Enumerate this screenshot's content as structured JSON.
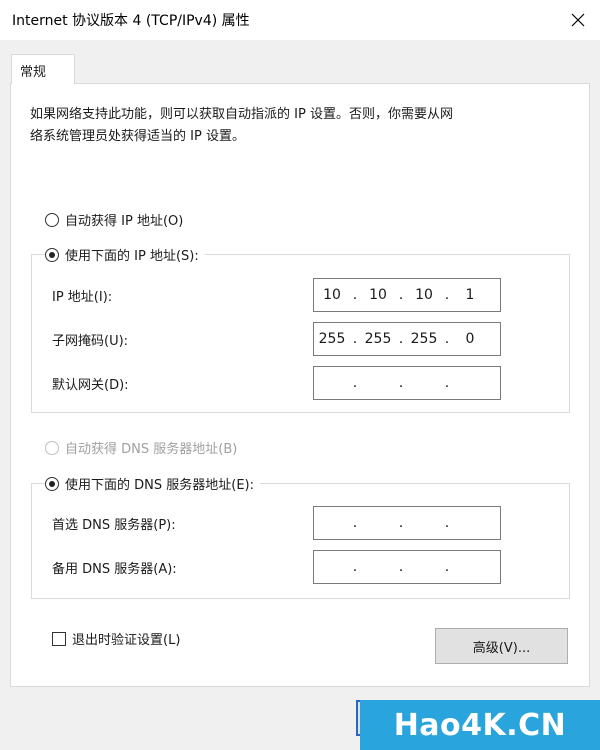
{
  "window": {
    "title": "Internet 协议版本 4 (TCP/IPv4) 属性"
  },
  "tabs": [
    {
      "label": "常规",
      "selected": true
    }
  ],
  "description": {
    "line1": "如果网络支持此功能，则可以获取自动指派的 IP 设置。否则，你需要从网",
    "line2": "络系统管理员处获得适当的 IP 设置。"
  },
  "ip_section": {
    "auto_label": "自动获得 IP 地址(O)",
    "auto_selected": false,
    "manual_label": "使用下面的 IP 地址(S):",
    "manual_selected": true,
    "fields": [
      {
        "label": "IP 地址(I):",
        "octets": [
          "10",
          "10",
          "10",
          "1"
        ]
      },
      {
        "label": "子网掩码(U):",
        "octets": [
          "255",
          "255",
          "255",
          "0"
        ]
      },
      {
        "label": "默认网关(D):",
        "octets": [
          "",
          "",
          "",
          ""
        ]
      }
    ]
  },
  "dns_section": {
    "auto_label": "自动获得 DNS 服务器地址(B)",
    "auto_selected": false,
    "auto_disabled": true,
    "manual_label": "使用下面的 DNS 服务器地址(E):",
    "manual_selected": true,
    "fields": [
      {
        "label": "首选 DNS 服务器(P):",
        "octets": [
          "",
          "",
          "",
          ""
        ]
      },
      {
        "label": "备用 DNS 服务器(A):",
        "octets": [
          "",
          "",
          "",
          ""
        ]
      }
    ]
  },
  "validate_on_exit": {
    "label": "退出时验证设置(L)",
    "checked": false
  },
  "advanced_button": {
    "label": "高级(V)..."
  },
  "watermark": {
    "text": "Hao4K.CN"
  },
  "colors": {
    "frame_bg": "#f0f0f0",
    "watermark_bg": "#2aa4dc",
    "focus_border": "#2a66c8"
  }
}
